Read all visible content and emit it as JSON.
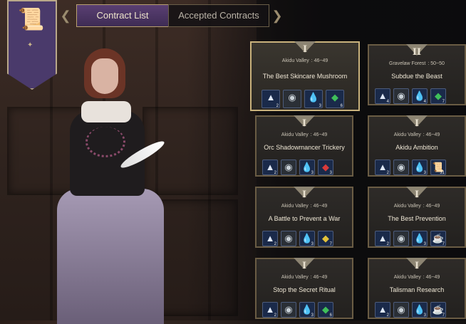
{
  "tabs": {
    "active": "Contract List",
    "inactive": "Accepted Contracts"
  },
  "contracts": [
    {
      "tier": "I",
      "region": "Akidu Valley",
      "level": ": 46~49",
      "name": "The Best Skincare Mushroom",
      "rewards": [
        {
          "icon": "crystal-shard-icon",
          "count": "2"
        },
        {
          "icon": "silver-coin-icon",
          "count": ""
        },
        {
          "icon": "water-drop-icon",
          "count": "3"
        },
        {
          "icon": "green-gem-icon",
          "count": "6"
        }
      ]
    },
    {
      "tier": "II",
      "region": "Gravelaw Forest",
      "level": ": 50~50",
      "name": "Subdue the Beast",
      "rewards": [
        {
          "icon": "crystal-shard-icon",
          "count": "4"
        },
        {
          "icon": "silver-coin-icon",
          "count": ""
        },
        {
          "icon": "water-drop-icon",
          "count": "4"
        },
        {
          "icon": "green-gem-icon",
          "count": "7"
        }
      ]
    },
    {
      "tier": "I",
      "region": "Akidu Valley",
      "level": ": 46~49",
      "name": "Orc Shadowmancer Trickery",
      "rewards": [
        {
          "icon": "crystal-shard-icon",
          "count": "2"
        },
        {
          "icon": "silver-coin-icon",
          "count": ""
        },
        {
          "icon": "water-drop-icon",
          "count": "3"
        },
        {
          "icon": "red-gem-icon",
          "count": "3"
        }
      ]
    },
    {
      "tier": "I",
      "region": "Akidu Valley",
      "level": ": 46~49",
      "name": "Akidu Ambition",
      "rewards": [
        {
          "icon": "crystal-shard-icon",
          "count": "2"
        },
        {
          "icon": "silver-coin-icon",
          "count": ""
        },
        {
          "icon": "water-drop-icon",
          "count": "3"
        },
        {
          "icon": "scroll-icon",
          "count": "31"
        }
      ]
    },
    {
      "tier": "I",
      "region": "Akidu Valley",
      "level": ": 46~49",
      "name": "A Battle to Prevent a War",
      "rewards": [
        {
          "icon": "crystal-shard-icon",
          "count": "2"
        },
        {
          "icon": "silver-coin-icon",
          "count": ""
        },
        {
          "icon": "water-drop-icon",
          "count": "3"
        },
        {
          "icon": "yellow-gem-icon",
          "count": "7"
        }
      ]
    },
    {
      "tier": "I",
      "region": "Akidu Valley",
      "level": ": 46~49",
      "name": "The Best Prevention",
      "rewards": [
        {
          "icon": "crystal-shard-icon",
          "count": "2"
        },
        {
          "icon": "silver-coin-icon",
          "count": ""
        },
        {
          "icon": "water-drop-icon",
          "count": "3"
        },
        {
          "icon": "potion-icon",
          "count": "7"
        }
      ]
    },
    {
      "tier": "I",
      "region": "Akidu Valley",
      "level": ": 46~49",
      "name": "Stop the Secret Ritual",
      "rewards": [
        {
          "icon": "crystal-shard-icon",
          "count": "2"
        },
        {
          "icon": "silver-coin-icon",
          "count": ""
        },
        {
          "icon": "water-drop-icon",
          "count": "3"
        },
        {
          "icon": "green-gem-icon",
          "count": "6"
        }
      ]
    },
    {
      "tier": "I",
      "region": "Akidu Valley",
      "level": ": 46~49",
      "name": "Talisman Research",
      "rewards": [
        {
          "icon": "crystal-shard-icon",
          "count": "2"
        },
        {
          "icon": "silver-coin-icon",
          "count": ""
        },
        {
          "icon": "water-drop-icon",
          "count": "3"
        },
        {
          "icon": "potion-icon",
          "count": "7"
        }
      ]
    }
  ]
}
